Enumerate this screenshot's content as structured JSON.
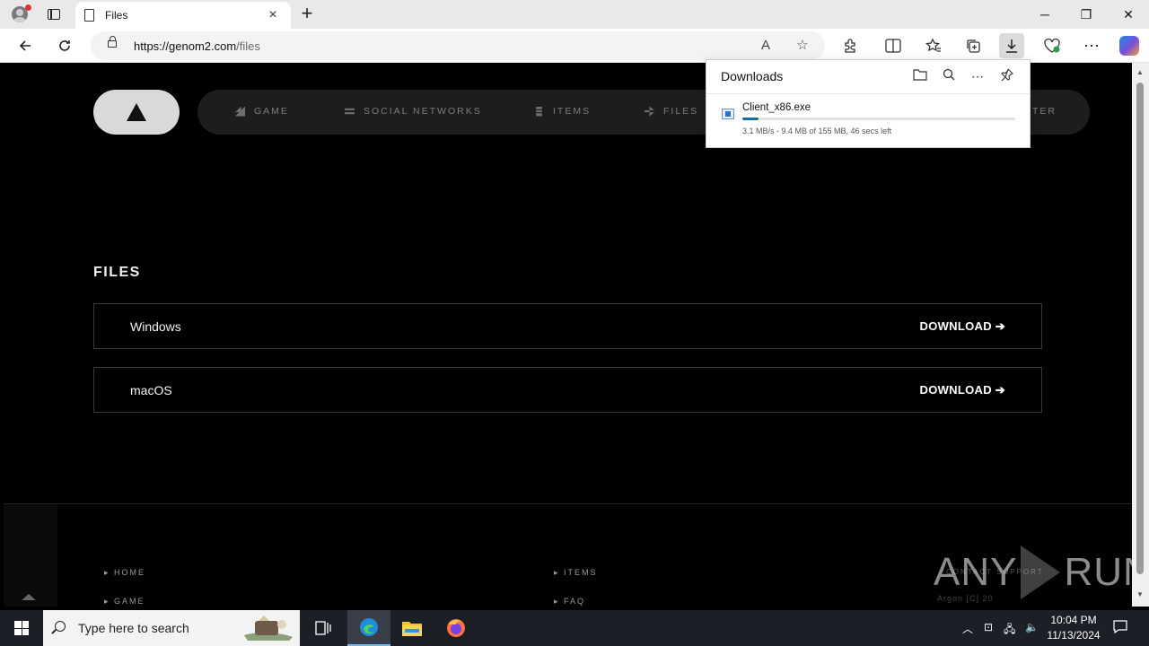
{
  "browser": {
    "tab_title": "Files",
    "url_host": "https://genom2.com",
    "url_path": "/files",
    "window_controls": {
      "minimize": "─",
      "restore": "❐",
      "close": "✕"
    }
  },
  "site": {
    "nav": [
      {
        "label": "GAME",
        "icon": "game-icon"
      },
      {
        "label": "SOCIAL NETWORKS",
        "icon": "share-icon"
      },
      {
        "label": "ITEMS",
        "icon": "items-icon"
      },
      {
        "label": "FILES",
        "icon": "files-icon"
      },
      {
        "label": "TER",
        "icon": ""
      }
    ],
    "section_title": "FILES",
    "downloads": [
      {
        "platform": "Windows",
        "action": "DOWNLOAD ➔"
      },
      {
        "platform": "macOS",
        "action": "DOWNLOAD ➔"
      }
    ],
    "footer": {
      "left_links": [
        "HOME",
        "GAME"
      ],
      "right_links": [
        "ITEMS",
        "FAQ"
      ],
      "contact": "CONTACT SUPPORT",
      "copyright": "Argon [C] 20"
    },
    "watermark": {
      "left": "ANY",
      "right": "RUN"
    }
  },
  "downloads_panel": {
    "title": "Downloads",
    "file_name": "Client_x86.exe",
    "status": "3.1 MB/s - 9.4 MB of 155 MB, 46 secs left",
    "progress": 0.06
  },
  "taskbar": {
    "search_placeholder": "Type here to search",
    "time": "10:04 PM",
    "date": "11/13/2024"
  }
}
